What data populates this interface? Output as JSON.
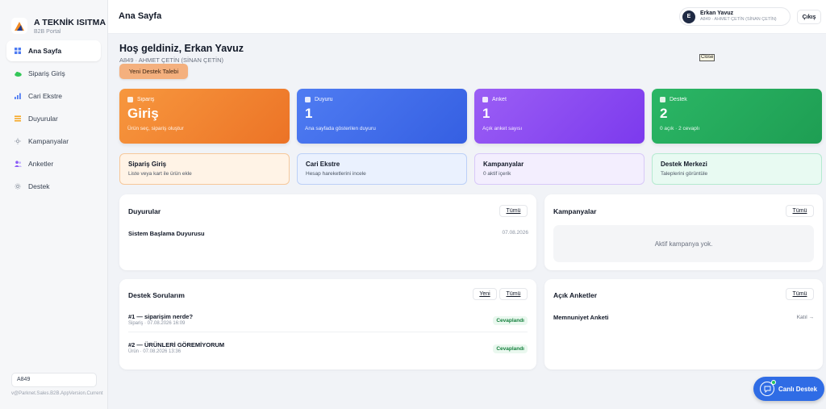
{
  "brand": {
    "title": "A TEKNİK ISITMA",
    "subtitle": "B2B Portal"
  },
  "sidebar": {
    "items": [
      {
        "label": "Ana Sayfa",
        "icon": "grid-icon"
      },
      {
        "label": "Sipariş Giriş",
        "icon": "cloud-icon"
      },
      {
        "label": "Cari Ekstre",
        "icon": "bar-chart-icon"
      },
      {
        "label": "Duyurular",
        "icon": "list-icon"
      },
      {
        "label": "Kampanyalar",
        "icon": "sun-icon"
      },
      {
        "label": "Anketler",
        "icon": "users-icon"
      },
      {
        "label": "Destek",
        "icon": "settings-icon"
      }
    ],
    "account_code": "A849",
    "version": "v@Parknet.Sales.B2B.AppVersion.Current"
  },
  "header": {
    "title": "Ana Sayfa",
    "user_initial": "E",
    "user_name": "Erkan Yavuz",
    "user_sub": "A849 · AHMET ÇETİN (SİNAN ÇETİN)",
    "logout_label": "Çıkış"
  },
  "welcome": {
    "title": "Hoş geldiniz, Erkan Yavuz",
    "subtitle": "A849 · AHMET ÇETİN (SİNAN ÇETİN)",
    "close_tooltip": "Close",
    "new_ticket_label": "Yeni Destek Talebi"
  },
  "stats": [
    {
      "label": "Sipariş",
      "value": "Giriş",
      "desc": "Ürün seç, sipariş oluştur",
      "color": "#f28a34"
    },
    {
      "label": "Duyuru",
      "value": "1",
      "desc": "Ana sayfada gösterilen duyuru",
      "color": "#426ee9"
    },
    {
      "label": "Anket",
      "value": "1",
      "desc": "Açık anket sayısı",
      "color": "#8b4cf0"
    },
    {
      "label": "Destek",
      "value": "2",
      "desc": "0 açık · 2 cevaplı",
      "color": "#25aa5c"
    }
  ],
  "quick_links": [
    {
      "title": "Sipariş Giriş",
      "sub": "Liste veya kart ile ürün ekle"
    },
    {
      "title": "Cari Ekstre",
      "sub": "Hesap hareketlerini incele"
    },
    {
      "title": "Kampanyalar",
      "sub": "0 aktif içerik"
    },
    {
      "title": "Destek Merkezi",
      "sub": "Taleplerini görüntüle"
    }
  ],
  "announcements": {
    "title": "Duyurular",
    "all_label": "Tümü",
    "items": [
      {
        "title": "Sistem Başlama Duyurusu",
        "date": "07.08.2026"
      }
    ]
  },
  "campaigns": {
    "title": "Kampanyalar",
    "all_label": "Tümü",
    "empty_text": "Aktif kampanya yok."
  },
  "tickets": {
    "title": "Destek Sorularım",
    "new_label": "Yeni",
    "all_label": "Tümü",
    "items": [
      {
        "title": "#1 — siparişim nerde?",
        "sub": "Sipariş · 07.08.2026 16:09",
        "status": "Cevaplandı"
      },
      {
        "title": "#2 — ÜRÜNLERİ GÖREMİYORUM",
        "sub": "Ürün · 07.08.2026 13:36",
        "status": "Cevaplandı"
      }
    ]
  },
  "surveys": {
    "title": "Açık Anketler",
    "all_label": "Tümü",
    "items": [
      {
        "title": "Memnuniyet Anketi",
        "action": "Katıl →"
      }
    ]
  },
  "live_support": {
    "label": "Canlı Destek"
  }
}
